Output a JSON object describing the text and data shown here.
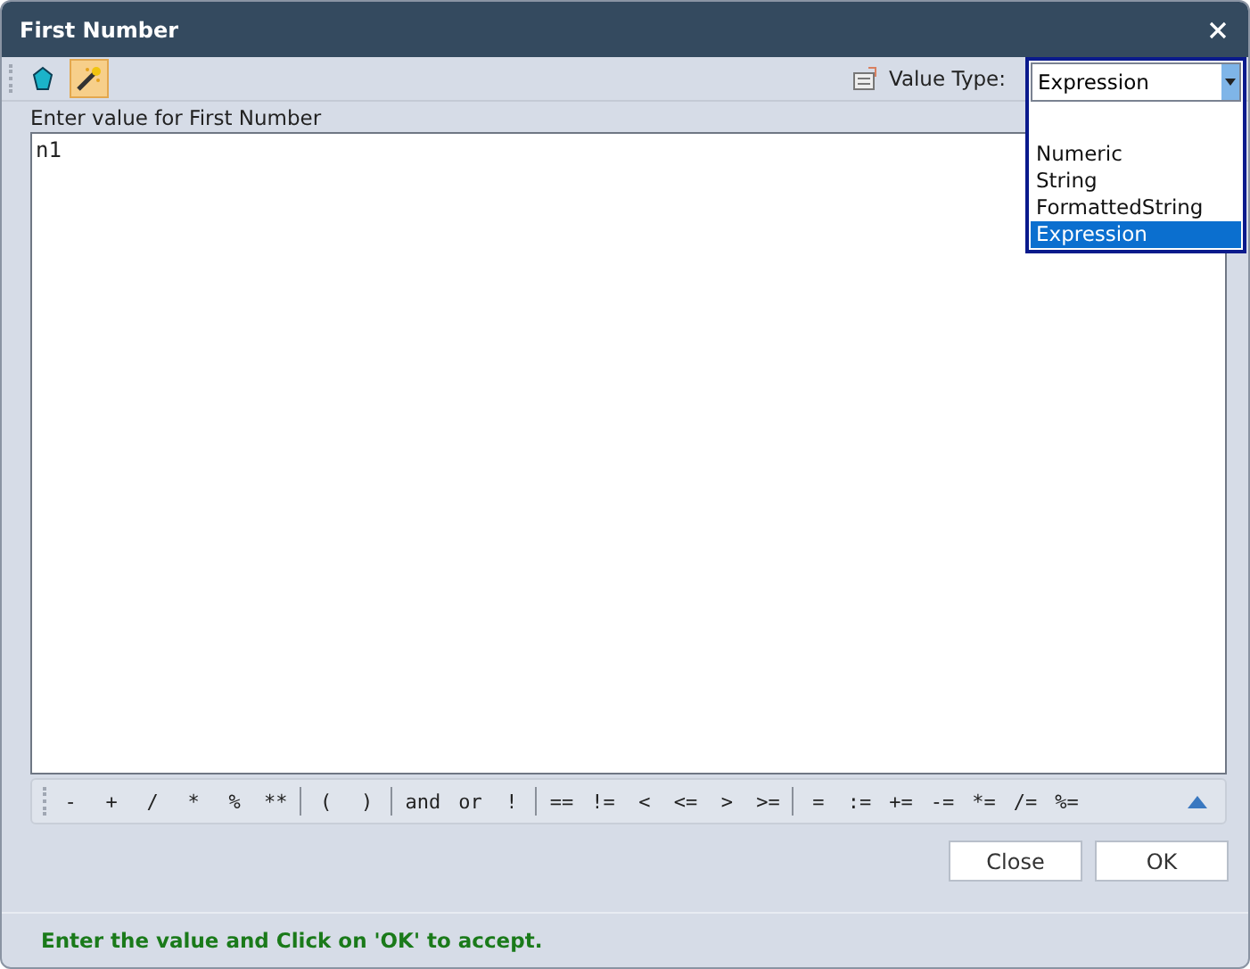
{
  "window": {
    "title": "First Number"
  },
  "toolbar": {
    "tools": [
      {
        "kind": "gem",
        "selected": false
      },
      {
        "kind": "wand",
        "selected": true
      }
    ],
    "value_type_label": "Value Type:",
    "value_type": "Expression"
  },
  "dropdown": {
    "options": [
      {
        "label": "Numeric",
        "selected": false
      },
      {
        "label": "String",
        "selected": false
      },
      {
        "label": "FormattedString",
        "selected": false
      },
      {
        "label": "Expression",
        "selected": true
      }
    ]
  },
  "prompt": "Enter value for First Number",
  "value": "n1",
  "operator_groups": [
    [
      "-",
      "+",
      "/",
      "*",
      "%",
      "**"
    ],
    [
      "(",
      ")"
    ],
    [
      "and",
      "or",
      "!"
    ],
    [
      "==",
      "!=",
      "<",
      "<=",
      ">",
      ">="
    ],
    [
      "=",
      ":=",
      "+=",
      "-=",
      "*=",
      "/=",
      "%="
    ]
  ],
  "buttons": [
    "Close",
    "OK"
  ],
  "status": "Enter the value and Click on 'OK' to accept."
}
